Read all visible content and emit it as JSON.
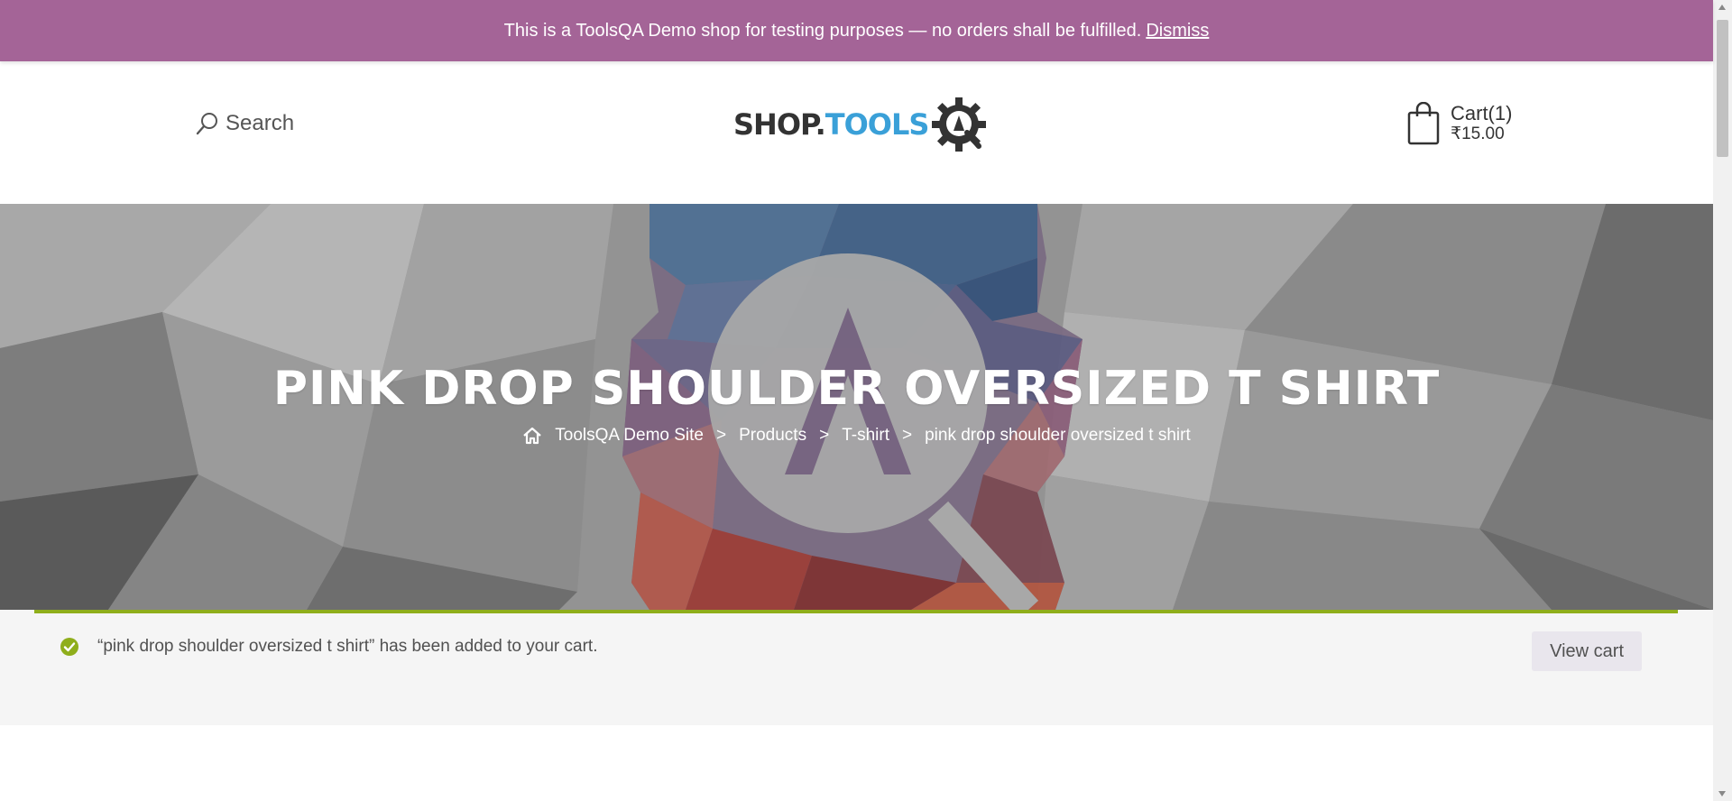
{
  "banner": {
    "text": "This is a ToolsQA Demo shop for testing purposes — no orders shall be fulfilled.",
    "dismiss": "Dismiss",
    "bg_color": "#a46497"
  },
  "header": {
    "search_label": "Search",
    "logo": {
      "shop": "SHOP.",
      "tools": "TOOLS"
    },
    "cart": {
      "label": "Cart(1)",
      "total": "₹15.00"
    }
  },
  "hero": {
    "title": "PINK DROP SHOULDER OVERSIZED T SHIRT",
    "breadcrumb": {
      "home": "ToolsQA Demo Site",
      "sep": ">",
      "products": "Products",
      "category": "T-shirt",
      "current": "pink drop shoulder oversized t shirt"
    }
  },
  "notice": {
    "message": "“pink drop shoulder oversized t shirt” has been added to your cart.",
    "button": "View cart",
    "accent_color": "#8fae1b"
  },
  "icons": {
    "search": "search-icon",
    "cart": "shopping-bag-icon",
    "home": "home-icon",
    "success": "check-circle-icon",
    "logo": "gear-magnifier-icon"
  }
}
